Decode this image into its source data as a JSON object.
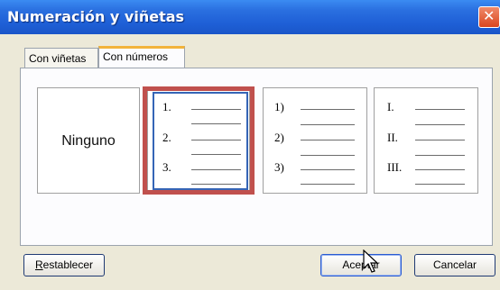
{
  "window": {
    "title": "Numeración y viñetas"
  },
  "tabs": [
    {
      "label": "Con viñetas",
      "active": false
    },
    {
      "label": "Con números",
      "active": true
    }
  ],
  "options": {
    "none_label": "Ninguno",
    "arabic": [
      "1.",
      "2.",
      "3."
    ],
    "paren": [
      "1)",
      "2)",
      "3)"
    ],
    "roman": [
      "I.",
      "II.",
      "III."
    ],
    "selected": "arabic"
  },
  "buttons": {
    "reset_accesskey": "R",
    "reset_rest": "establecer",
    "ok_label": "Aceptar",
    "cancel_label": "Cancelar"
  },
  "colors": {
    "titlebar": "#1e5fd6",
    "highlight": "#c0504d",
    "selection": "#3565b6"
  },
  "icons": [
    "close-icon",
    "mouse-cursor-icon"
  ]
}
